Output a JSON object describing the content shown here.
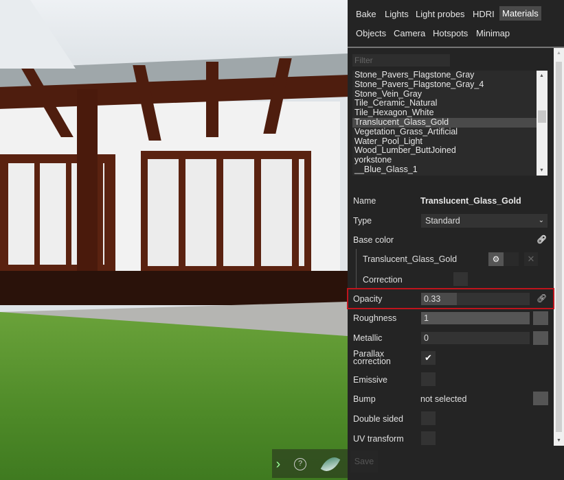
{
  "tabs": [
    {
      "label": "Bake",
      "active": false
    },
    {
      "label": "Lights",
      "active": false
    },
    {
      "label": "Light probes",
      "active": false
    },
    {
      "label": "HDRI",
      "active": false
    },
    {
      "label": "Materials",
      "active": true
    },
    {
      "label": "Objects",
      "active": false
    },
    {
      "label": "Camera",
      "active": false
    },
    {
      "label": "Hotspots",
      "active": false
    },
    {
      "label": "Minimap",
      "active": false
    }
  ],
  "filter": {
    "placeholder": "Filter",
    "value": ""
  },
  "materials": [
    "Stone_Pavers_Flagstone_Gray",
    "Stone_Pavers_Flagstone_Gray_4",
    "Stone_Vein_Gray",
    "Tile_Ceramic_Natural",
    "Tile_Hexagon_White",
    "Translucent_Glass_Gold",
    "Vegetation_Grass_Artificial",
    "Water_Pool_Light",
    "Wood_Lumber_ButtJoined",
    "yorkstone",
    "__Blue_Glass_1"
  ],
  "selected_material": "Translucent_Glass_Gold",
  "props": {
    "name_label": "Name",
    "name_value": "Translucent_Glass_Gold",
    "type_label": "Type",
    "type_value": "Standard",
    "base_color_label": "Base color",
    "base_color_texture": "Translucent_Glass_Gold",
    "correction_label": "Correction",
    "opacity_label": "Opacity",
    "opacity_value": "0.33",
    "opacity_fraction": 0.33,
    "roughness_label": "Roughness",
    "roughness_value": "1",
    "metallic_label": "Metallic",
    "metallic_value": "0",
    "parallax_label_1": "Parallax",
    "parallax_label_2": "correction",
    "parallax_checked": true,
    "emissive_label": "Emissive",
    "emissive_checked": false,
    "bump_label": "Bump",
    "bump_value": "not selected",
    "double_sided_label": "Double sided",
    "double_sided_checked": false,
    "uv_label": "UV transform",
    "uv_checked": false,
    "save_label": "Save"
  },
  "colors": {
    "highlight": "#c0141c",
    "panel": "#242424"
  },
  "viewer_buttons": [
    {
      "icon": "chevron-right-icon"
    },
    {
      "icon": "help-icon"
    },
    {
      "icon": "feather-logo-icon"
    }
  ]
}
